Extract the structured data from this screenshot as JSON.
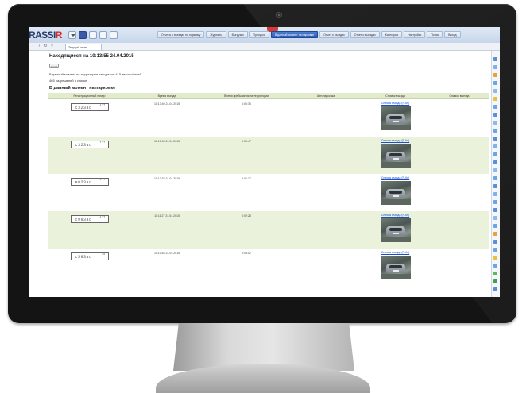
{
  "app": {
    "logo_main": "RASSI",
    "logo_accent": "R"
  },
  "menu": {
    "tabs": [
      {
        "label": "Отчеты о въездах на парковку",
        "active": false
      },
      {
        "label": "Журналы",
        "active": false
      },
      {
        "label": "Выгрузки",
        "active": false
      },
      {
        "label": "Пропуска",
        "active": false
      },
      {
        "label": "В данный момент на парковке",
        "active": true
      },
      {
        "label": "Отчет о въездах",
        "active": false
      },
      {
        "label": "Отчет о выездах",
        "active": false
      },
      {
        "label": "Категории",
        "active": false
      },
      {
        "label": "Настройки",
        "active": false
      },
      {
        "label": "Поиск",
        "active": false
      },
      {
        "label": "Выход",
        "active": false
      }
    ]
  },
  "tab_bar": {
    "doc_tab_label": "Текущий отчет"
  },
  "page": {
    "title": "Находящиеся на 10:13:55 24.04.2015",
    "back_label": "Назад",
    "info_line_1": "В данный момент на территории находится: 415 автомобилей",
    "info_line_2": "465 разрешений в списке",
    "section_heading": "В данный момент на парковке"
  },
  "table": {
    "headers": [
      "Регистрационный номер",
      "Время въезда",
      "Время пребывания на территории",
      "Автопарковка",
      "Снимок въезда",
      "Снимок выезда"
    ],
    "rows": [
      {
        "plate": "с323ас",
        "region": "177",
        "entry_time": "10:13:40 24.04.2015",
        "duration": "0:00:15",
        "parking": "",
        "photo_link": "Снимок въезда (Р-Кн)"
      },
      {
        "plate": "с323ас",
        "region": "777",
        "entry_time": "10:13:08 24.04.2015",
        "duration": "0:00:47",
        "parking": "",
        "photo_link": "Снимок въезда (Р-Кн)"
      },
      {
        "plate": "в023ас",
        "region": "177",
        "entry_time": "10:12:38 24.04.2015",
        "duration": "0:01:17",
        "parking": "",
        "photo_link": "Снимок въезда (Р-Кн)"
      },
      {
        "plate": "с993ас",
        "region": "177",
        "entry_time": "10:11:27 24.04.2015",
        "duration": "0:02:28",
        "parking": "",
        "photo_link": "Снимок въезда (Р-Кн)"
      },
      {
        "plate": "с593ас",
        "region": "50",
        "entry_time": "10:10:53 24.04.2015",
        "duration": "0:03:02",
        "parking": "",
        "photo_link": "Снимок въезда (Р-Кн)"
      }
    ]
  },
  "colors": {
    "header_row": "#e3ebcd",
    "stripe_row": "#ebf2dc",
    "active_tab": "#2c5db5",
    "link": "#1a4fc9",
    "bezel": "#141414"
  },
  "icons": [
    "back-icon",
    "forward-icon",
    "refresh-icon",
    "home-icon",
    "print-icon",
    "settings-icon",
    "edit-icon",
    "webcam-icon"
  ]
}
